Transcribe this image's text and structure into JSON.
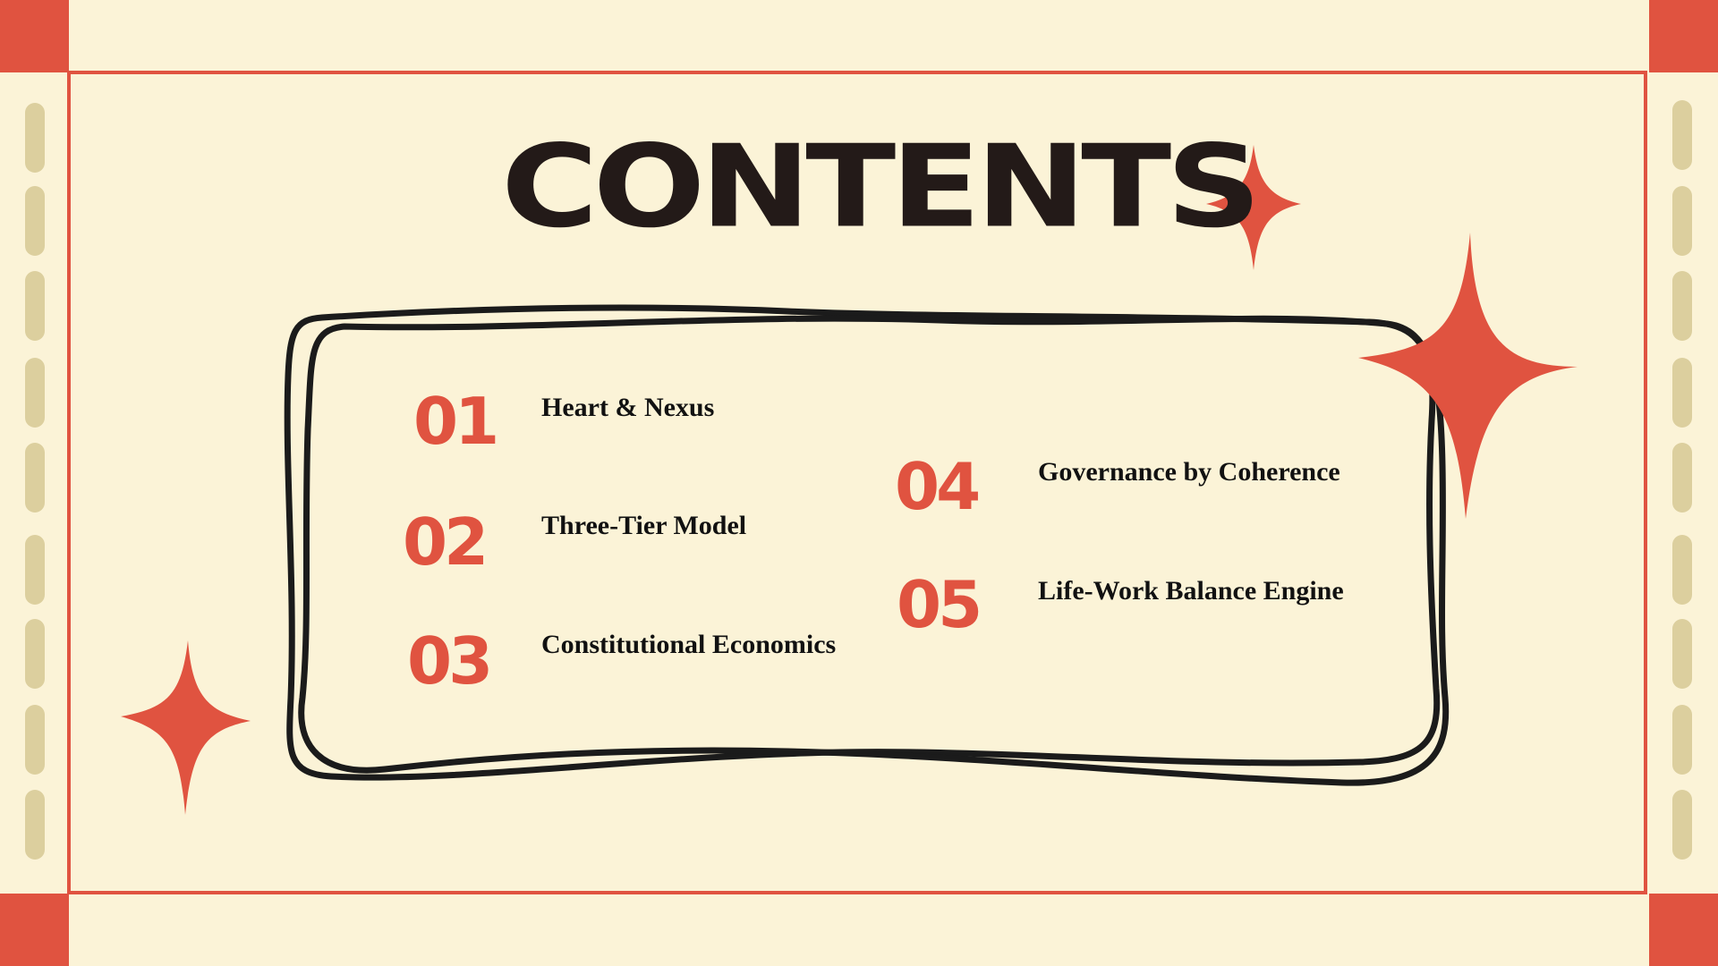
{
  "slide": {
    "title": "CONTENTS",
    "items": [
      {
        "number": "01",
        "label": "Heart & Nexus"
      },
      {
        "number": "02",
        "label": "Three-Tier Model"
      },
      {
        "number": "03",
        "label": "Constitutional Economics"
      },
      {
        "number": "04",
        "label": "Governance by Coherence"
      },
      {
        "number": "05",
        "label": "Life-Work Balance Engine"
      }
    ]
  },
  "colors": {
    "background": "#fbf3d7",
    "accent": "#e05340",
    "ink": "#231a18",
    "pill": "#dccf9e"
  },
  "decorations": [
    "sparkle-star-icon",
    "hand-drawn-frame"
  ]
}
